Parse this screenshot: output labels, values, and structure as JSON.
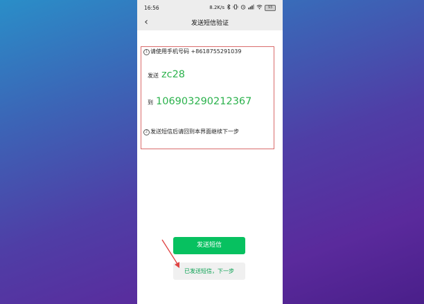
{
  "status_bar": {
    "time": "16:56",
    "network_speed": "8.2K/s",
    "icons": [
      "bluetooth-icon",
      "vibrate-icon",
      "alarm-icon",
      "signal-icon",
      "wifi-icon",
      "battery-icon"
    ],
    "battery_label": "93"
  },
  "header": {
    "back_icon": "chevron-left-icon",
    "back_glyph": "‹",
    "title": "发送短信验证"
  },
  "instructions": {
    "step1_num": "1",
    "step1_text": "请使用手机号码 +8618755291039",
    "send_prefix": "发送",
    "send_code": "zc28",
    "to_prefix": "到",
    "to_number": "106903290212367",
    "step2_num": "2",
    "step2_text": "发送短信后请回到本界面继续下一步"
  },
  "actions": {
    "send_sms_label": "发送短信",
    "next_step_label": "已发送短信，下一步"
  },
  "colors": {
    "accent_green": "#07c160",
    "code_green": "#2bb24c",
    "annotation_red": "#d96a6a",
    "arrow_red": "#e04545"
  }
}
